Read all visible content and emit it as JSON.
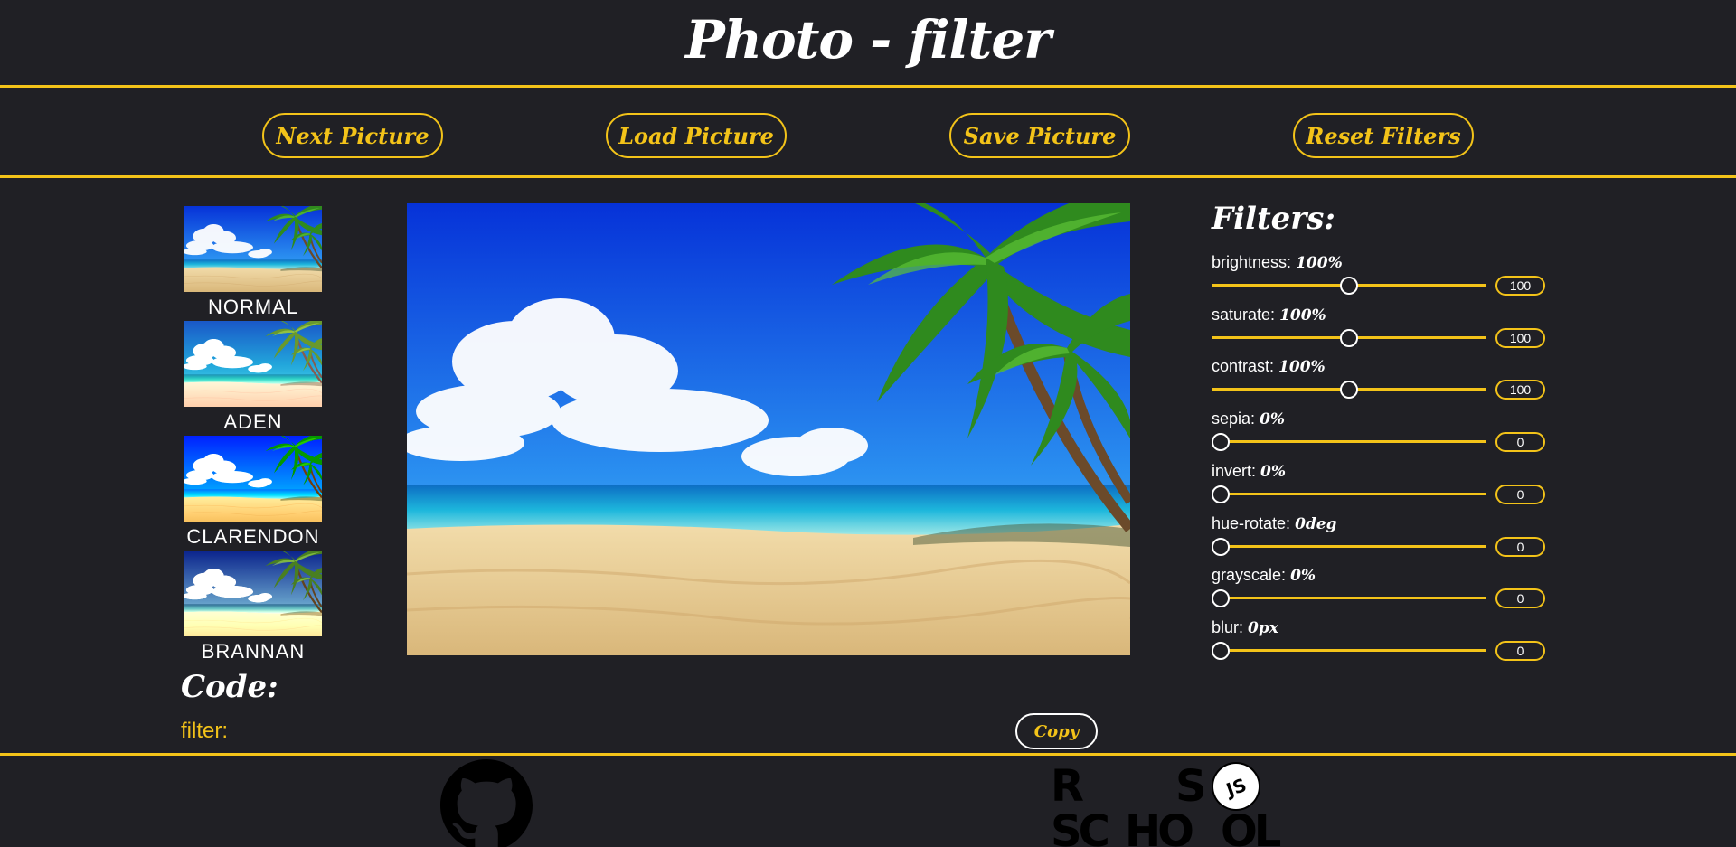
{
  "header": {
    "title": "Photo - filter"
  },
  "toolbar": {
    "buttons": [
      {
        "label": "Next Picture"
      },
      {
        "label": "Load Picture"
      },
      {
        "label": "Save Picture"
      },
      {
        "label": "Reset Filters"
      }
    ]
  },
  "presets": [
    {
      "label": "NORMAL"
    },
    {
      "label": "ADEN"
    },
    {
      "label": "CLARENDON"
    },
    {
      "label": "BRANNAN"
    }
  ],
  "filters": {
    "title": "Filters:",
    "items": [
      {
        "name": "brightness:",
        "value_display": "100%",
        "input_value": "100",
        "level": 0.5
      },
      {
        "name": "saturate:",
        "value_display": "100%",
        "input_value": "100",
        "level": 0.5
      },
      {
        "name": "contrast:",
        "value_display": "100%",
        "input_value": "100",
        "level": 0.5
      },
      {
        "name": "sepia:",
        "value_display": "0%",
        "input_value": "0",
        "level": 0
      },
      {
        "name": "invert:",
        "value_display": "0%",
        "input_value": "0",
        "level": 0
      },
      {
        "name": "hue-rotate:",
        "value_display": "0deg",
        "input_value": "0",
        "level": 0
      },
      {
        "name": "grayscale:",
        "value_display": "0%",
        "input_value": "0",
        "level": 0
      },
      {
        "name": "blur:",
        "value_display": "0px",
        "input_value": "0",
        "level": 0
      }
    ]
  },
  "code": {
    "title": "Code:",
    "text": "filter:",
    "copy_label": "Copy"
  },
  "footer": {
    "rs_letters": [
      "R",
      "S",
      "SC",
      "HO",
      "OL"
    ],
    "js_badge": "JS"
  },
  "colors": {
    "accent": "#f3c319",
    "background": "#202025"
  },
  "icons": [
    "github-icon",
    "rs-school-logo"
  ]
}
